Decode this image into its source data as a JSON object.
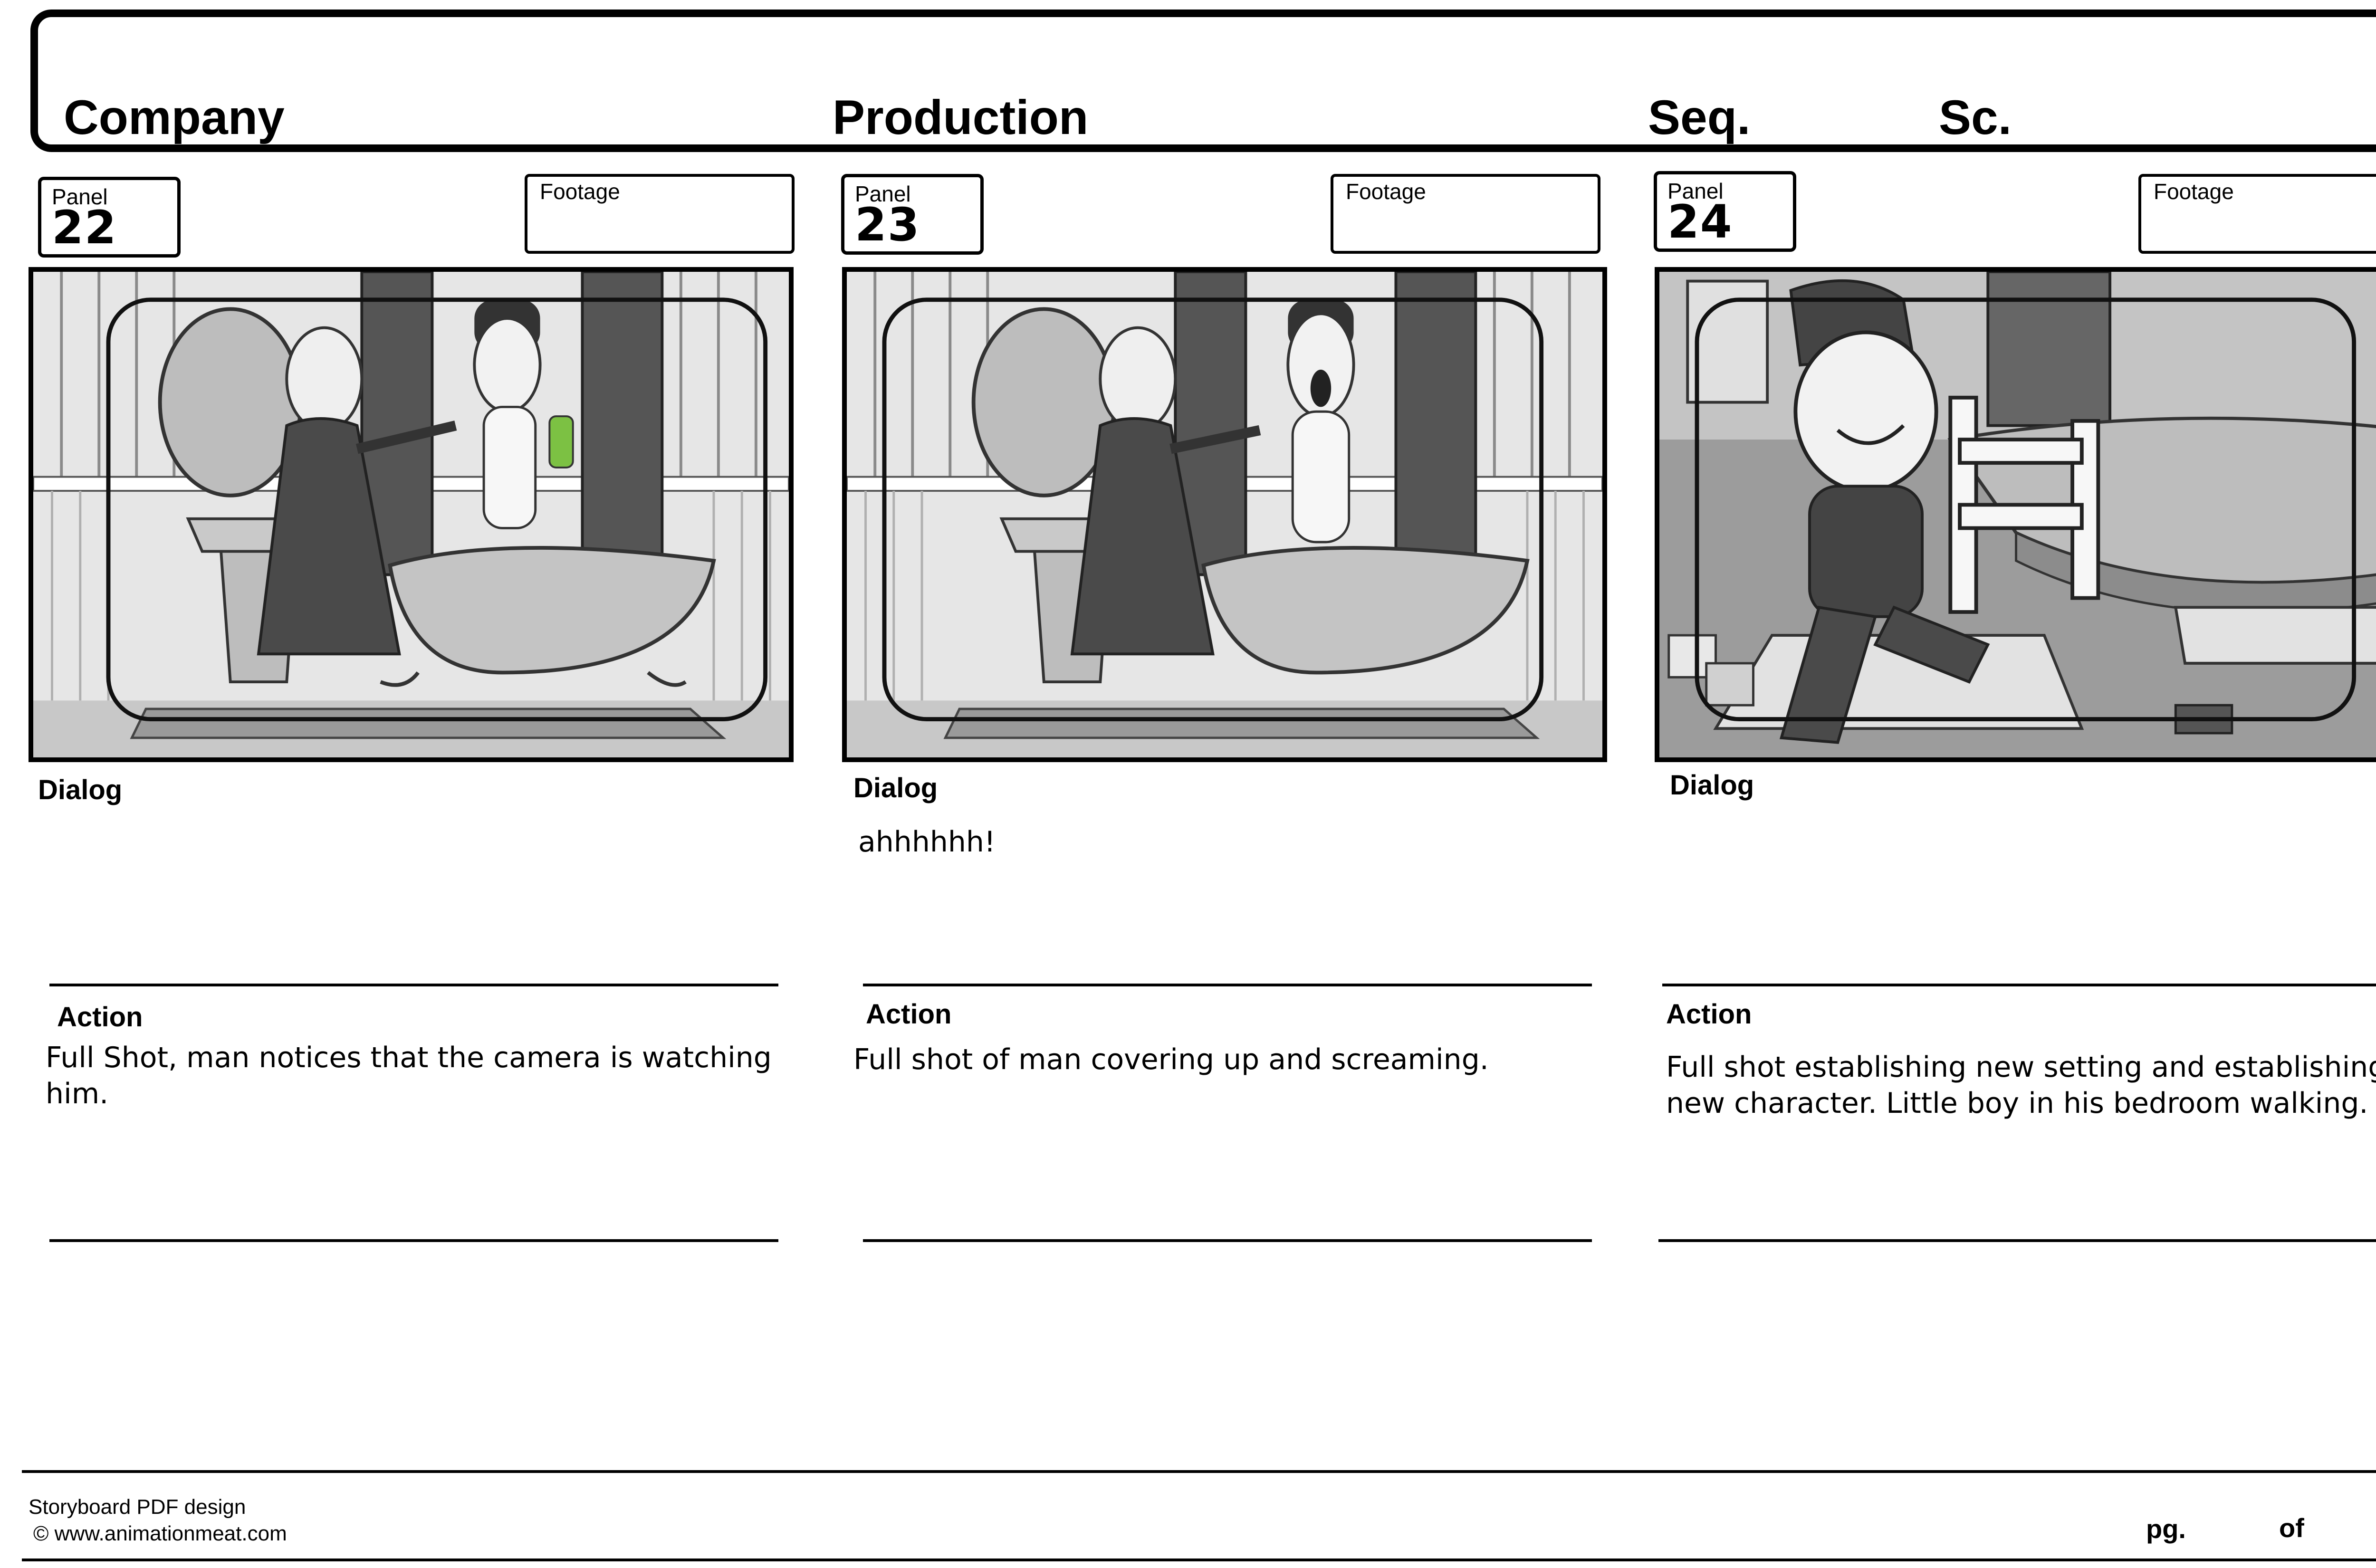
{
  "header": {
    "company_label": "Company",
    "production_label": "Production",
    "seq_label": "Seq.",
    "sc_label": "Sc."
  },
  "panels": [
    {
      "panel_label": "Panel",
      "number": "22",
      "footage_label": "Footage",
      "dialog_label": "Dialog",
      "dialog": "",
      "action_label": "Action",
      "action": "Full Shot, man notices that the camera is watching him."
    },
    {
      "panel_label": "Panel",
      "number": "23",
      "footage_label": "Footage",
      "dialog_label": "Dialog",
      "dialog": "ahhhhhh!",
      "action_label": "Action",
      "action": "Full shot of man covering up and screaming."
    },
    {
      "panel_label": "Panel",
      "number": "24",
      "footage_label": "Footage",
      "dialog_label": "Dialog",
      "dialog": "",
      "action_label": "Action",
      "action": "Full shot establishing new setting and establishing new character. Little boy in his bedroom walking."
    }
  ],
  "footer": {
    "design_credit": "Storyboard PDF design",
    "copyright": "© www.animationmeat.com",
    "page_label": "pg.",
    "of_label": "of"
  }
}
